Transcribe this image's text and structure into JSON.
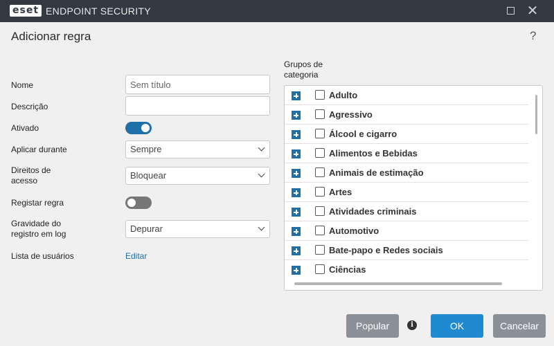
{
  "titlebar": {
    "logo": "eset",
    "product": "ENDPOINT SECURITY"
  },
  "dialog": {
    "title": "Adicionar regra",
    "help": "?"
  },
  "form": {
    "nome_label": "Nome",
    "nome_placeholder": "Sem título",
    "descricao_label": "Descrição",
    "descricao_value": "",
    "ativado_label": "Ativado",
    "ativado_on": true,
    "aplicar_label": "Aplicar durante",
    "aplicar_value": "Sempre",
    "direitos_label_1": "Direitos de",
    "direitos_label_2": "acesso",
    "direitos_value": "Bloquear",
    "registrar_label": "Registar regra",
    "registrar_on": false,
    "gravidade_label_1": "Gravidade do",
    "gravidade_label_2": "registro em log",
    "gravidade_value": "Depurar",
    "usuarios_label": "Lista de usuários",
    "usuarios_link": "Editar"
  },
  "categories": {
    "label_1": "Grupos de",
    "label_2": "categoria",
    "items": [
      {
        "name": "Adulto",
        "checked": false
      },
      {
        "name": "Agressivo",
        "checked": false
      },
      {
        "name": "Álcool e cigarro",
        "checked": false
      },
      {
        "name": "Alimentos e Bebidas",
        "checked": false
      },
      {
        "name": "Animais de estimação",
        "checked": false
      },
      {
        "name": "Artes",
        "checked": false
      },
      {
        "name": "Atividades criminais",
        "checked": false
      },
      {
        "name": "Automotivo",
        "checked": false
      },
      {
        "name": "Bate-papo e Redes sociais",
        "checked": false
      },
      {
        "name": "Ciências",
        "checked": false
      }
    ]
  },
  "buttons": {
    "popular": "Popular",
    "ok": "OK",
    "cancel": "Cancelar"
  },
  "icons": {
    "info": "info-icon",
    "expand": "plus-icon",
    "help": "help-icon"
  },
  "colors": {
    "accent": "#1f6fa8",
    "ok": "#1f8ad0",
    "titlebar": "#323941"
  }
}
